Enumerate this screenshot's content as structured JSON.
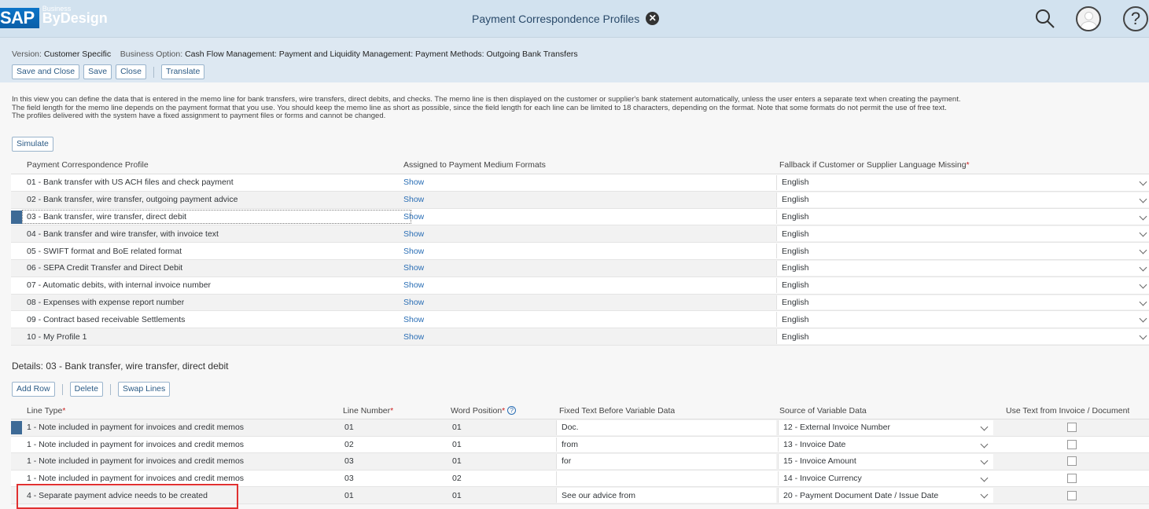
{
  "shell": {
    "logo_sap": "SAP",
    "logo_line1": "Business",
    "logo_line2": "ByDesign",
    "title": "Payment Correspondence Profiles",
    "close_glyph": "✕",
    "icons": [
      "search-icon",
      "user-avatar-icon",
      "help-icon"
    ]
  },
  "version": {
    "version_label": "Version:",
    "version_value": "Customer Specific",
    "option_label": "Business Option:",
    "option_value": "Cash Flow Management: Payment and Liquidity Management: Payment Methods: Outgoing Bank Transfers"
  },
  "toolbar": {
    "save_close": "Save and Close",
    "save": "Save",
    "close": "Close",
    "translate": "Translate"
  },
  "info": {
    "line1": "In this view you can define the data that is entered in the memo line for bank transfers, wire transfers, direct debits, and checks. The memo line is then displayed on the customer or supplier's bank statement automatically, unless the user enters a separate text when creating the payment.",
    "line2": "The field length for the memo line depends on the payment format that you use. You should keep the memo line as short as possible, since the field length for each line can be limited to 18 characters, depending on the format. Note that some formats do not permit the use of free text.",
    "line3": "The profiles delivered with the system have a fixed assignment to payment files or forms and cannot be changed."
  },
  "simulate": "Simulate",
  "profiles": {
    "headers": {
      "profile": "Payment Correspondence Profile",
      "assigned": "Assigned to Payment Medium Formats",
      "fallback": "Fallback if Customer or Supplier Language Missing",
      "required_mark": "*"
    },
    "rows": [
      {
        "profile": "01 - Bank transfer with US ACH files and check payment",
        "assigned": "Show",
        "fallback": "English"
      },
      {
        "profile": "02 - Bank transfer, wire transfer, outgoing payment advice",
        "assigned": "Show",
        "fallback": "English"
      },
      {
        "profile": "03 - Bank transfer, wire transfer, direct debit",
        "assigned": "Show",
        "fallback": "English"
      },
      {
        "profile": "04 - Bank transfer and wire transfer, with invoice text",
        "assigned": "Show",
        "fallback": "English"
      },
      {
        "profile": "05 - SWIFT format and BoE related format",
        "assigned": "Show",
        "fallback": "English"
      },
      {
        "profile": "06 - SEPA Credit Transfer and Direct Debit",
        "assigned": "Show",
        "fallback": "English"
      },
      {
        "profile": "07 - Automatic debits, with internal invoice number",
        "assigned": "Show",
        "fallback": "English"
      },
      {
        "profile": "08 - Expenses with expense report number",
        "assigned": "Show",
        "fallback": "English"
      },
      {
        "profile": "09 - Contract based receivable Settlements",
        "assigned": "Show",
        "fallback": "English"
      },
      {
        "profile": "10 - My Profile 1",
        "assigned": "Show",
        "fallback": "English"
      }
    ]
  },
  "details": {
    "title": "Details: 03 - Bank transfer, wire transfer, direct debit",
    "add_row": "Add Row",
    "delete": "Delete",
    "swap_lines": "Swap Lines",
    "headers": {
      "line_type": "Line Type",
      "line_number": "Line Number",
      "word_position": "Word Position",
      "fixed_text": "Fixed Text Before Variable Data",
      "source": "Source of Variable Data",
      "use_text": "Use Text from Invoice / Document",
      "required_mark": "*",
      "help_glyph": "?"
    },
    "rows": [
      {
        "line_type": "1 - Note included in payment for invoices and credit memos",
        "line_number": "01",
        "word_position": "01",
        "fixed_text": "Doc.",
        "source": "12 - External Invoice Number"
      },
      {
        "line_type": "1 - Note included in payment for invoices and credit memos",
        "line_number": "02",
        "word_position": "01",
        "fixed_text": "from",
        "source": "13 - Invoice Date"
      },
      {
        "line_type": "1 - Note included in payment for invoices and credit memos",
        "line_number": "03",
        "word_position": "01",
        "fixed_text": "for",
        "source": "15 - Invoice Amount"
      },
      {
        "line_type": "1 - Note included in payment for invoices and credit memos",
        "line_number": "03",
        "word_position": "02",
        "fixed_text": "",
        "source": "14 - Invoice Currency"
      },
      {
        "line_type": "4 - Separate payment advice needs to be created",
        "line_number": "01",
        "word_position": "01",
        "fixed_text": "See our advice from",
        "source": "20 - Payment Document Date / Issue Date"
      }
    ]
  }
}
